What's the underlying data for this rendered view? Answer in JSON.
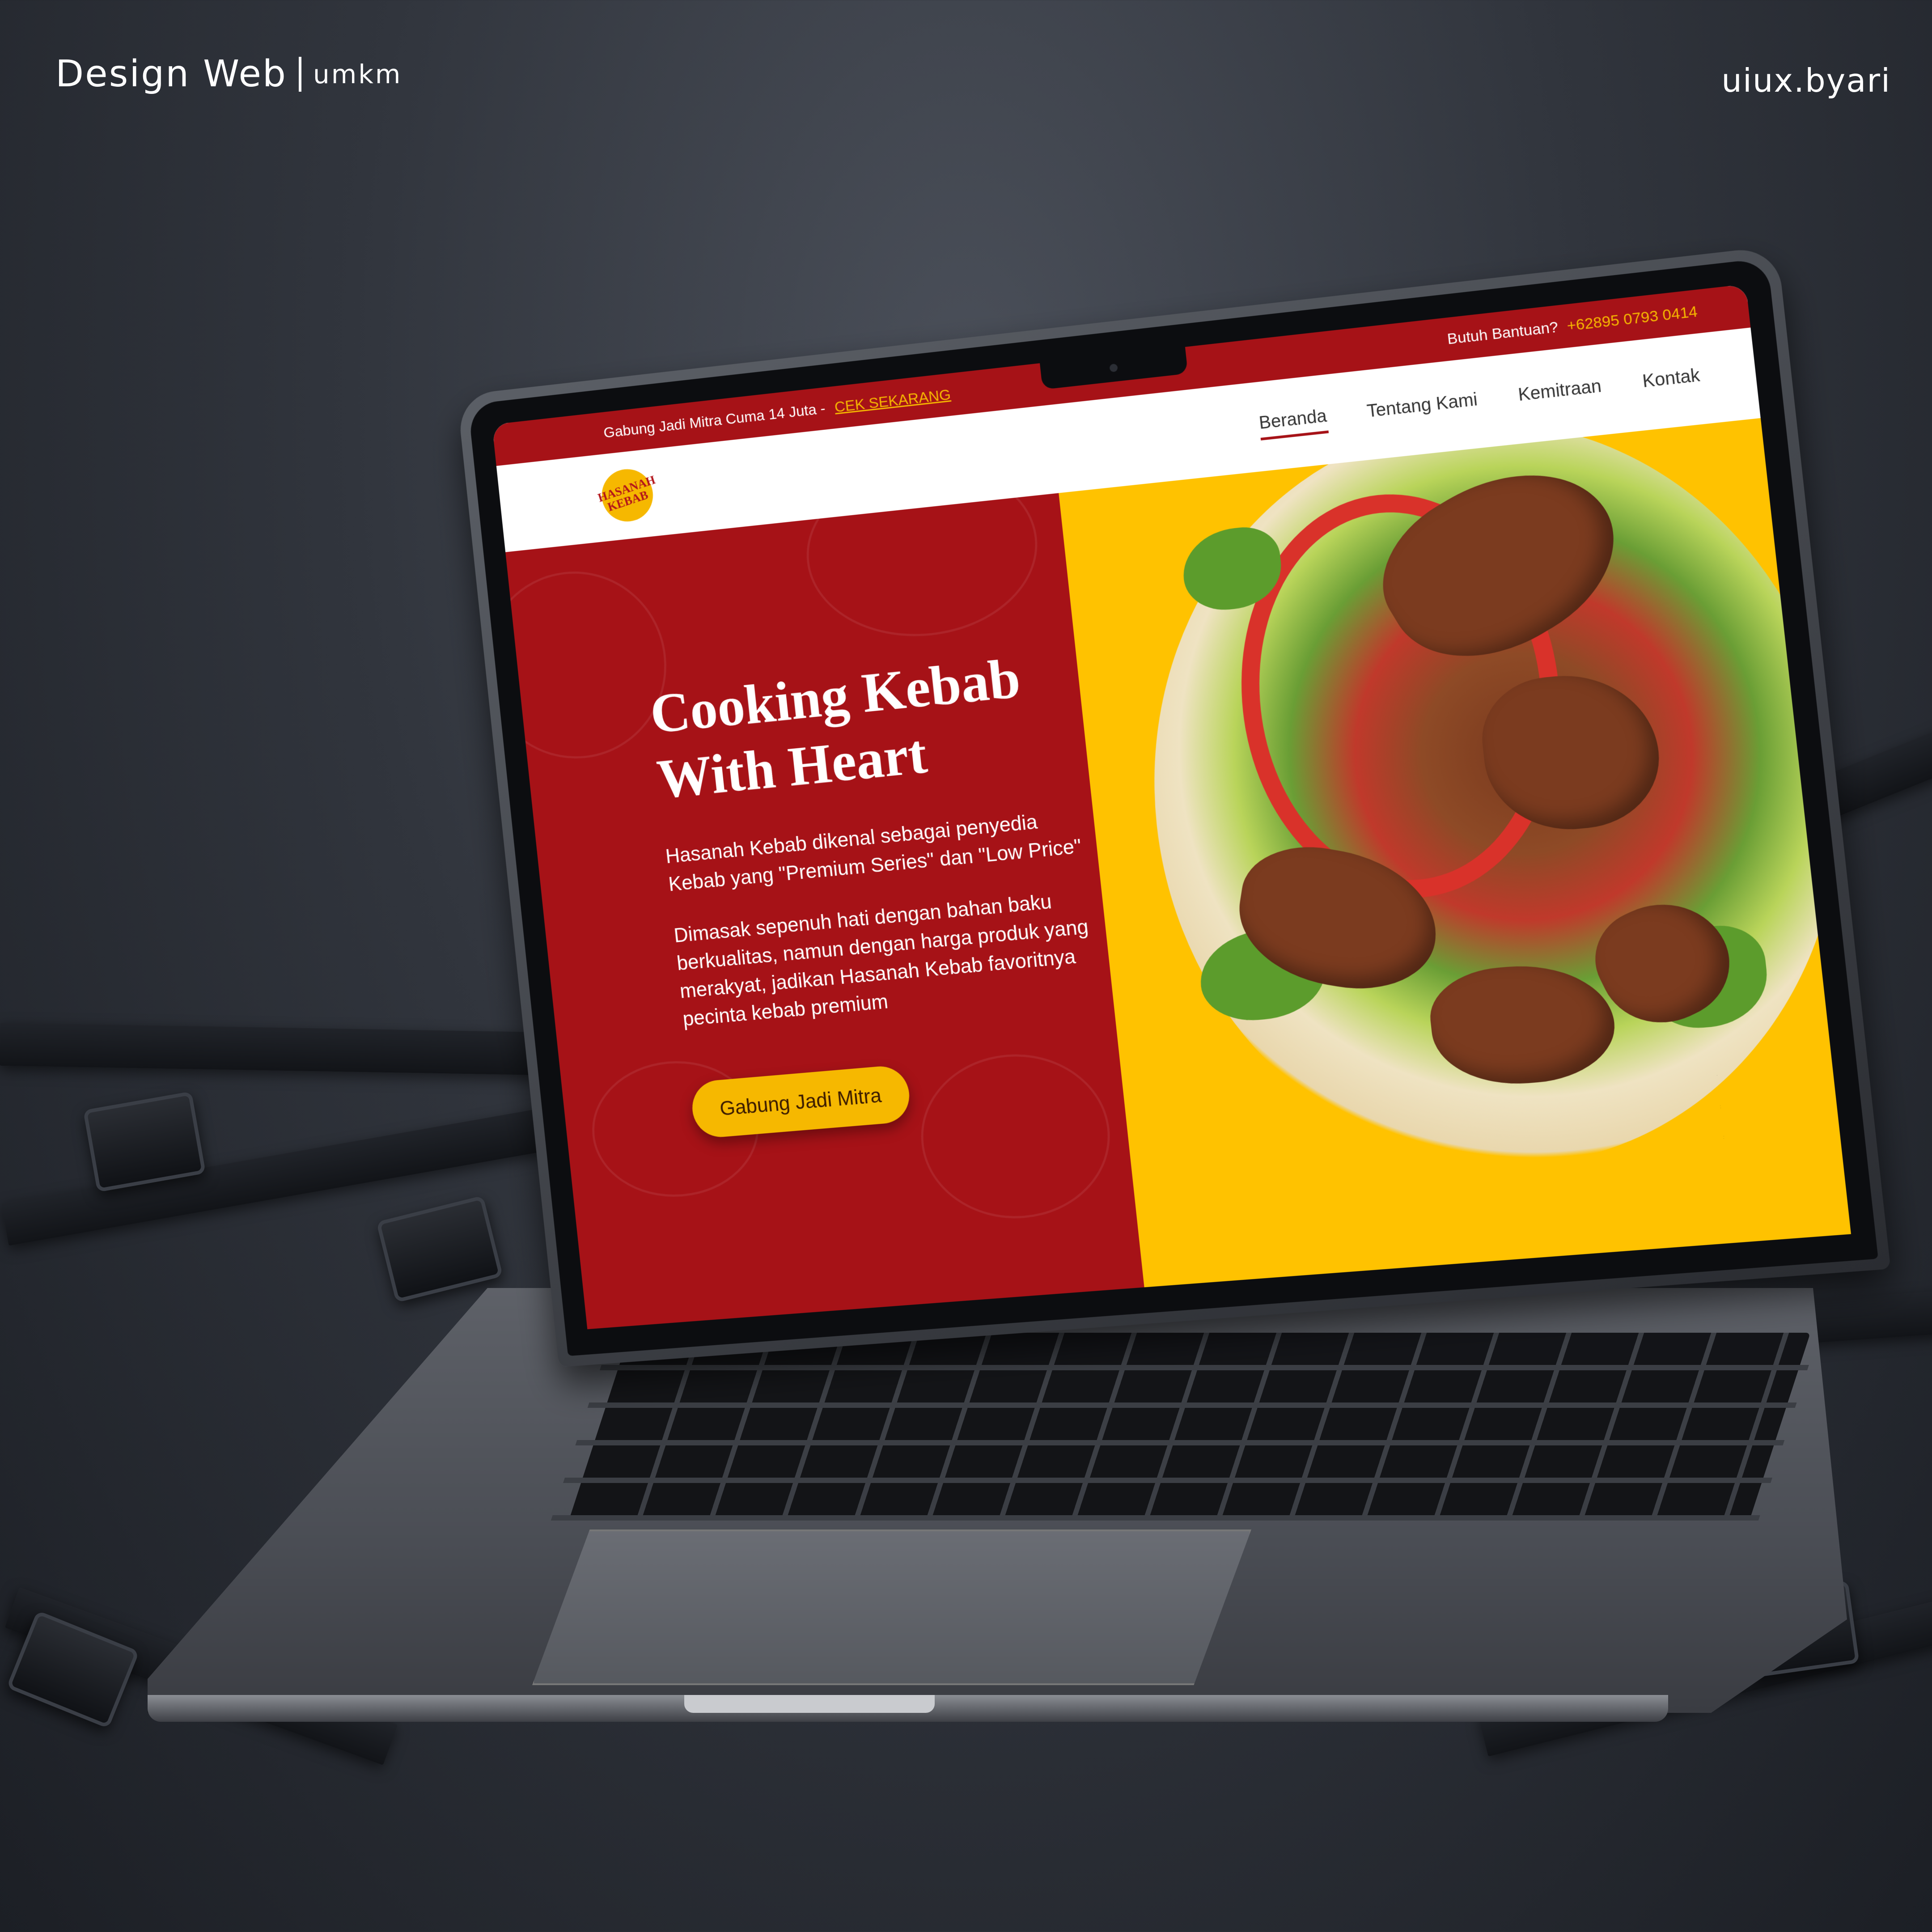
{
  "overlay": {
    "brand_title": "Design Web",
    "brand_sub": "umkm",
    "author": "uiux.byari"
  },
  "site": {
    "topbar": {
      "promo_text": "Gabung Jadi Mitra Cuma 14 Juta -",
      "promo_link": "CEK SEKARANG",
      "help_text": "Butuh Bantuan?",
      "phone": "+62895 0793 0414"
    },
    "logo": {
      "line1": "HASANAH",
      "line2": "KEBAB"
    },
    "nav": [
      {
        "label": "Beranda",
        "active": true
      },
      {
        "label": "Tentang Kami"
      },
      {
        "label": "Kemitraan"
      },
      {
        "label": "Kontak"
      }
    ],
    "hero": {
      "title_line1": "Cooking Kebab",
      "title_line2": "With Heart",
      "paragraph1": "Hasanah Kebab dikenal sebagai penyedia Kebab yang \"Premium Series\" dan \"Low Price\"",
      "paragraph2": "Dimasak sepenuh hati dengan bahan baku berkualitas, namun dengan harga produk yang merakyat, jadikan Hasanah Kebab favoritnya pecinta kebab premium",
      "cta": "Gabung Jadi Mitra"
    },
    "colors": {
      "primary": "#a61217",
      "accent": "#ffc200",
      "link": "#f6b800"
    }
  }
}
